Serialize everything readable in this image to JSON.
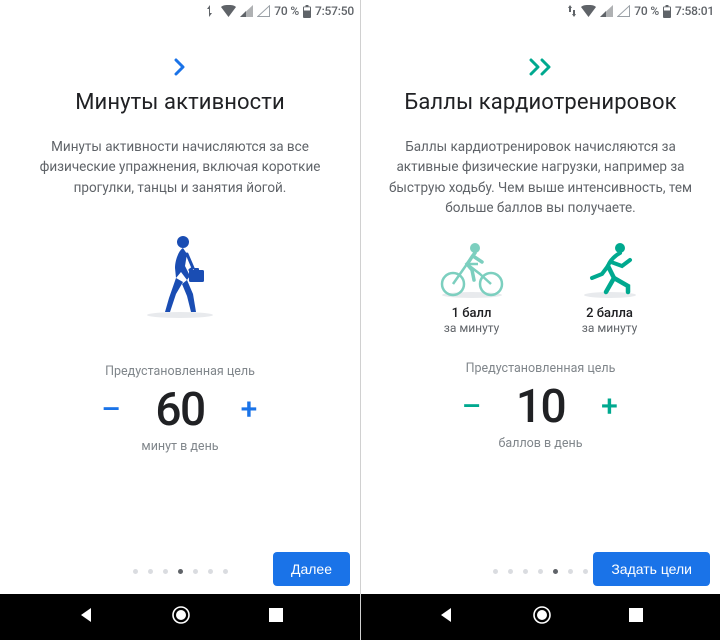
{
  "colors": {
    "blue": "#1a73e8",
    "teal": "#00a98f",
    "grey_text": "#5f6368",
    "grey_light": "#80868b"
  },
  "left": {
    "statusbar": {
      "battery": "70 %",
      "time": "7:57:50"
    },
    "accent": "#1a73e8",
    "title": "Минуты активности",
    "desc": "Минуты активности начисляются за все физические упражнения, включая короткие прогулки, танцы и занятия йогой.",
    "goal": {
      "label": "Предустановленная цель",
      "value": "60",
      "unit": "минут в день"
    },
    "pager": {
      "count": 7,
      "active": 3
    },
    "button": "Далее"
  },
  "right": {
    "statusbar": {
      "battery": "70 %",
      "time": "7:58:01"
    },
    "accent": "#00a98f",
    "title": "Баллы кардиотренировок",
    "desc": "Баллы кардиотренировок начисляются за активные физические нагрузки, например за быструю ходьбу. Чем выше интенсивность, тем больше баллов вы получаете.",
    "activities": [
      {
        "label": "1 балл",
        "sub": "за минуту"
      },
      {
        "label": "2 балла",
        "sub": "за минуту"
      }
    ],
    "goal": {
      "label": "Предустановленная цель",
      "value": "10",
      "unit": "баллов в день"
    },
    "pager": {
      "count": 7,
      "active": 4
    },
    "button": "Задать цели"
  },
  "nav_icons": [
    "back",
    "home",
    "recents"
  ]
}
